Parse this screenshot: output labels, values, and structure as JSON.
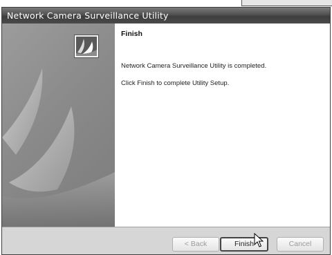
{
  "window": {
    "title": "Network Camera Surveillance Utility"
  },
  "content": {
    "heading": "Finish",
    "message": "Network Camera Surveillance Utility is completed.",
    "instruction": "Click Finish to complete Utility Setup."
  },
  "buttons": {
    "back_label": "< Back",
    "finish_label": "Finish",
    "cancel_label": "Cancel"
  },
  "icons": {
    "wizard": "wizard-logo-icon",
    "cursor": "mouse-pointer-icon"
  }
}
